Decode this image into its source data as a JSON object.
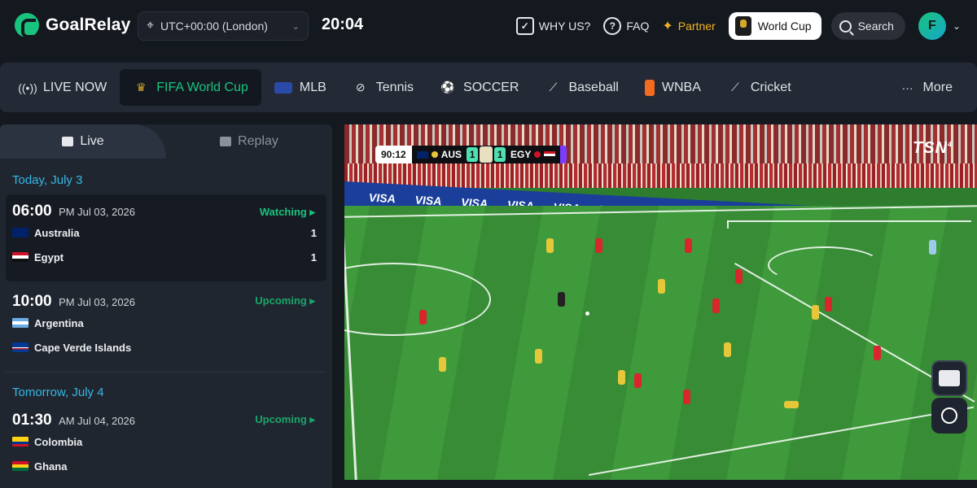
{
  "brand": {
    "name": "GoalRelay"
  },
  "timezone": {
    "label": "UTC+00:00 (London)"
  },
  "clock": "20:04",
  "topnav": {
    "why_us": "WHY US?",
    "faq": "FAQ",
    "partner": "Partner",
    "world_cup": "World Cup",
    "search": "Search",
    "avatar_initial": "F"
  },
  "sports": [
    {
      "label": "LIVE NOW",
      "icon": "live-signal-icon",
      "active": false
    },
    {
      "label": "FIFA World Cup",
      "icon": "world-cup-trophy-icon",
      "active": true
    },
    {
      "label": "MLB",
      "icon": "mlb-logo-icon",
      "active": false
    },
    {
      "label": "Tennis",
      "icon": "tennis-racket-icon",
      "active": false
    },
    {
      "label": "SOCCER",
      "icon": "soccer-ball-icon",
      "active": false
    },
    {
      "label": "Baseball",
      "icon": "baseball-bat-icon",
      "active": false
    },
    {
      "label": "WNBA",
      "icon": "wnba-logo-icon",
      "active": false
    },
    {
      "label": "Cricket",
      "icon": "cricket-bat-icon",
      "active": false
    },
    {
      "label": "More",
      "icon": "more-dots-icon",
      "active": false
    }
  ],
  "tabs": {
    "live": "Live",
    "replay": "Replay"
  },
  "schedule": {
    "today_heading": "Today, July 3",
    "tomorrow_heading": "Tomorrow, July 4",
    "matches": [
      {
        "time": "06:00",
        "sub": "PM Jul 03, 2026",
        "status": "Watching ▸",
        "home": "Australia",
        "home_score": "1",
        "away": "Egypt",
        "away_score": "1"
      },
      {
        "time": "10:00",
        "sub": "PM Jul 03, 2026",
        "status": "Upcoming ▸",
        "home": "Argentina",
        "away": "Cape Verde Islands"
      },
      {
        "time": "01:30",
        "sub": "AM Jul 04, 2026",
        "status": "Upcoming ▸",
        "home": "Colombia",
        "away": "Ghana"
      }
    ]
  },
  "player": {
    "clock": "90:12",
    "home_code": "AUS",
    "home_score": "1",
    "away_code": "EGY",
    "away_score": "1",
    "broadcaster": "TSN",
    "broadcaster_channel": "4",
    "ad_text": "VISA"
  },
  "colors": {
    "accent": "#19c37d",
    "link_blue": "#35b8e8",
    "partner_gold": "#f2b321"
  }
}
